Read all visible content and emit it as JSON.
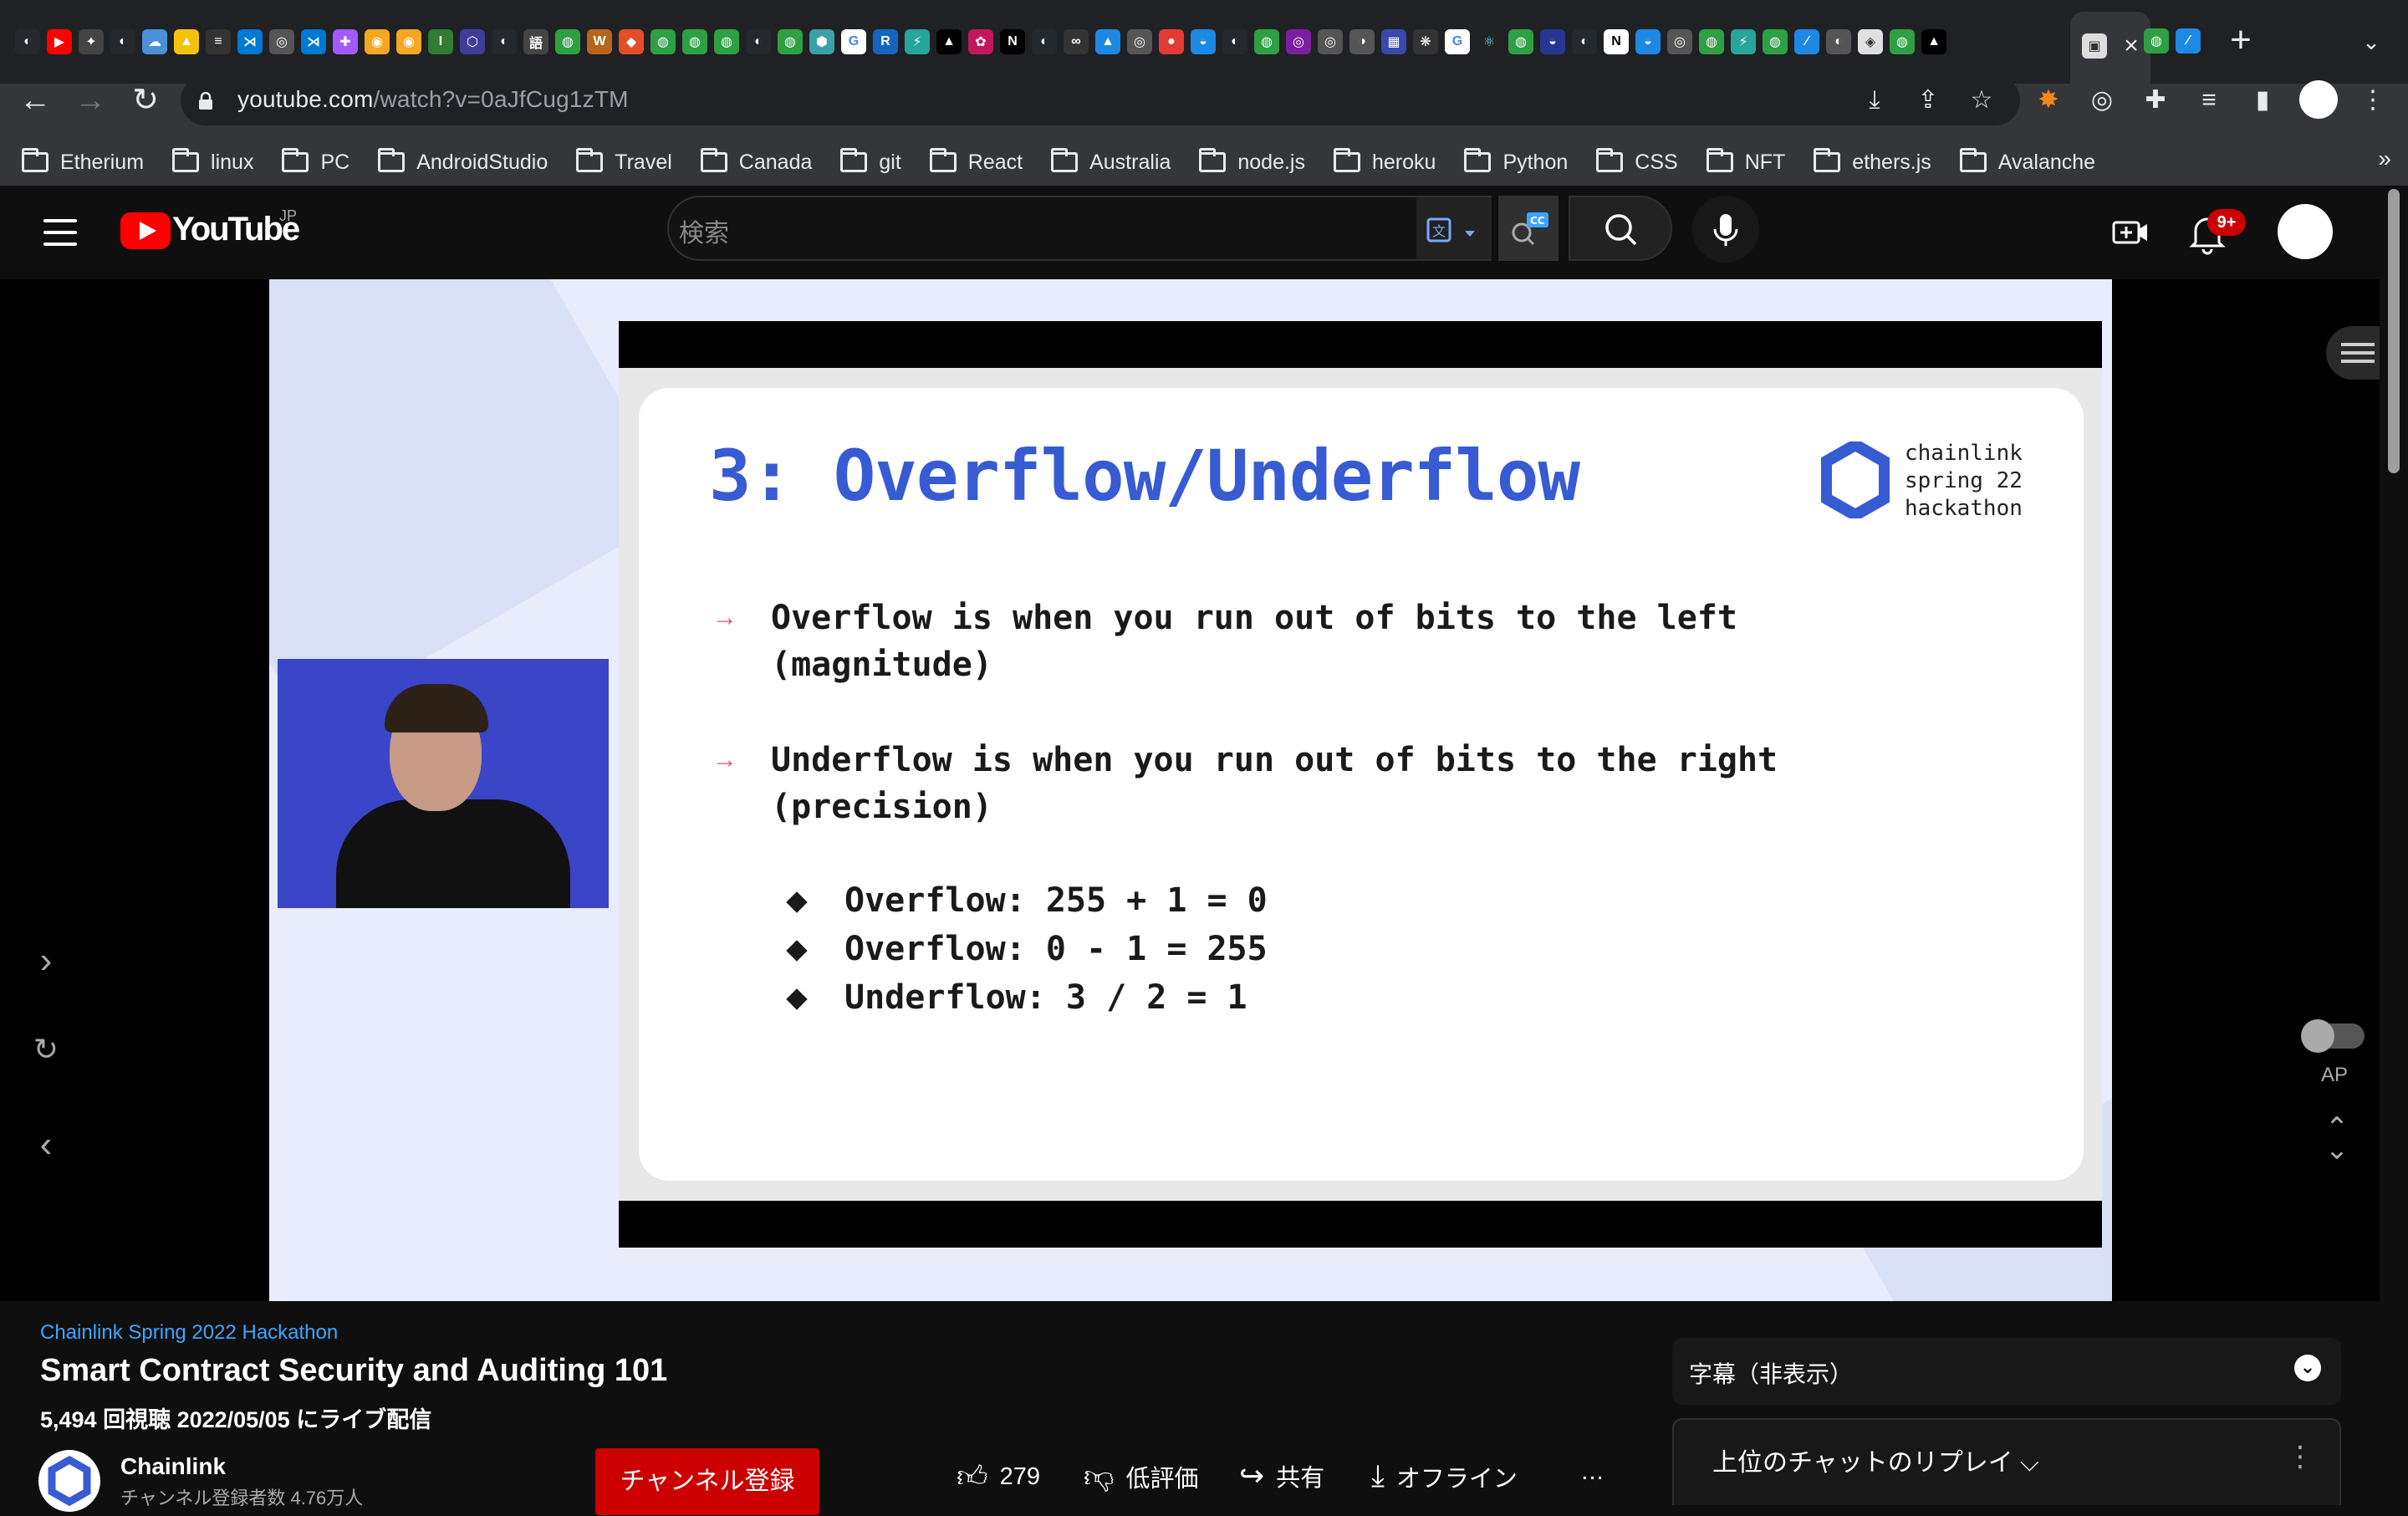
{
  "browser": {
    "active_tab_close": "×",
    "new_tab": "+",
    "tab_search": "⌄",
    "url_host": "youtube.com",
    "url_path": "/watch?v=0aJfCug1zTM",
    "bookmarks": [
      "Etherium",
      "linux",
      "PC",
      "AndroidStudio",
      "Travel",
      "Canada",
      "git",
      "React",
      "Australia",
      "node.js",
      "heroku",
      "Python",
      "CSS",
      "NFT",
      "ethers.js",
      "Avalanche"
    ],
    "bookmarks_more": "»"
  },
  "youtube": {
    "logo_text": "YouTube",
    "region": "JP",
    "search_placeholder": "検索",
    "notification_count": "9+"
  },
  "slide": {
    "title": "3: Overflow/Underflow",
    "brand_text": "chainlink\nspring 22\nhackathon",
    "bullet1_line1": "Overflow is when you run out of bits to the left",
    "bullet1_line2": "(magnitude)",
    "bullet2_line1": "Underflow is when you run out of bits to the right",
    "bullet2_line2": "(precision)",
    "sub1": "Overflow: 255 + 1 = 0",
    "sub2": "Overflow: 0 - 1 = 255",
    "sub3": "Underflow: 3 / 2 = 1",
    "arrow": "→"
  },
  "player": {
    "autoplay_label": "AP"
  },
  "video": {
    "hashtag": "Chainlink Spring 2022 Hackathon",
    "title": "Smart Contract Security and Auditing 101",
    "meta": "5,494 回視聴  2022/05/05 にライブ配信",
    "channel_name": "Chainlink",
    "channel_subs": "チャンネル登録者数 4.76万人",
    "subscribe_label": "チャンネル登録",
    "likes": "279",
    "dislike_label": "低評価",
    "share_label": "共有",
    "offline_label": "オフライン",
    "more_label": "…"
  },
  "side_panel": {
    "captions_label": "字幕（非表示）",
    "chat_replay_label": "上位のチャットのリプレイ",
    "chat_replay_chevron": "⌵",
    "menu_dots": "⋮"
  },
  "colors": {
    "slide_title": "#375bd2",
    "bullet_arrow": "#e8506b",
    "yt_red": "#ff0000",
    "subscribe": "#cc0000",
    "link": "#3ea6ff"
  }
}
